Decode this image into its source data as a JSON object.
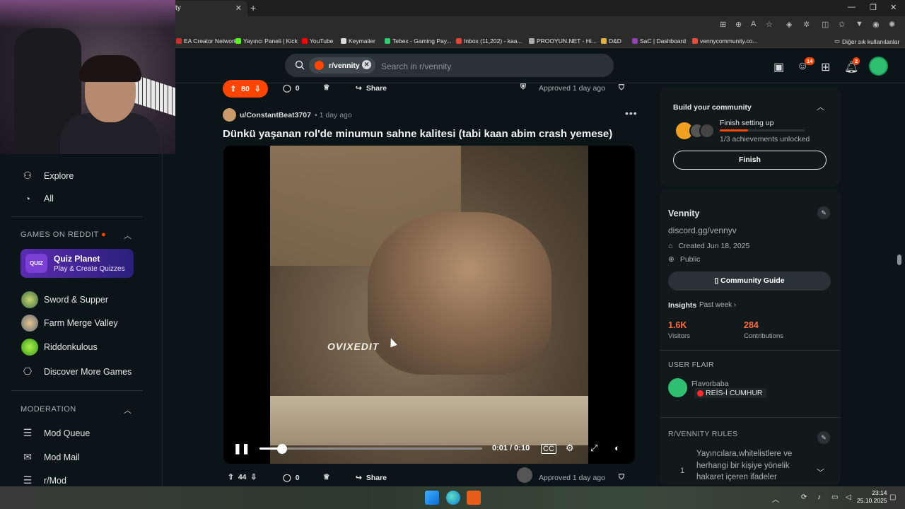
{
  "browser": {
    "tab_title": "ty",
    "bookmarks": [
      {
        "label": "EA Creator Network",
        "color": "#c9302c"
      },
      {
        "label": "Yayıncı Paneli | Kick",
        "color": "#53fc18"
      },
      {
        "label": "YouTube",
        "color": "#ff0000"
      },
      {
        "label": "Keymailer",
        "color": "#d9d9d9"
      },
      {
        "label": "Tebex - Gaming Pay...",
        "color": "#2ecc71"
      },
      {
        "label": "Inbox (11,202) - kaa...",
        "color": "#ea4335"
      },
      {
        "label": "PROOYUN.NET - Hi...",
        "color": "#aaaaaa"
      },
      {
        "label": "D&D",
        "color": "#e0b040"
      },
      {
        "label": "SaC | Dashboard",
        "color": "#8e44ad"
      },
      {
        "label": "vennycommunity.co...",
        "color": "#e74c3c"
      }
    ],
    "other_bookmarks": "Diğer sık kullanılanlar"
  },
  "header": {
    "community_chip": "r/vennity",
    "search_placeholder": "Search in r/vennity",
    "chat_badge": "14",
    "notif_badge": "2"
  },
  "sidebar": {
    "explore": "Explore",
    "all": "All",
    "games_heading": "GAMES ON REDDIT",
    "quiz": {
      "logo": "QUIZ",
      "title": "Quiz Planet",
      "subtitle": "Play & Create Quizzes"
    },
    "games": [
      "Sword & Supper",
      "Farm Merge Valley",
      "Riddonkulous"
    ],
    "discover": "Discover More Games",
    "moderation_heading": "MODERATION",
    "mod_items": [
      "Mod Queue",
      "Mod Mail",
      "r/Mod"
    ]
  },
  "post_prev": {
    "votes": "80",
    "comments": "0",
    "share": "Share",
    "approved": "Approved 1 day ago"
  },
  "post": {
    "user": "u/ConstantBeat3707",
    "time": "• 1 day ago",
    "title": "Dünkü yaşanan rol'de minumun sahne kalitesi (tabi kaan abim crash yemese)",
    "watermark": "OVIXEDIT",
    "video_time": "0:01 / 0:10",
    "progress": 0.1
  },
  "post_next": {
    "votes": "44",
    "comments": "0",
    "share": "Share",
    "approved": "Approved 1 day ago"
  },
  "right": {
    "build_title": "Build your community",
    "finish_title": "Finish setting up",
    "finish_sub": "1/3 achievements unlocked",
    "finish_progress": 0.33,
    "finish_btn": "Finish",
    "name": "Vennity",
    "desc": "discord.gg/vennyv",
    "created": "Created Jun 18, 2025",
    "visibility": "Public",
    "guide_btn": "Community Guide",
    "insights": "Insights",
    "insights_period": "Past week ›",
    "visitors_n": "1.6K",
    "visitors_l": "Visitors",
    "contrib_n": "284",
    "contrib_l": "Contributions",
    "user_flair_head": "USER FLAIR",
    "flair_user": "Flavorbaba",
    "flair_text": "REİS-İ CUMHUR",
    "rules_head": "R/VENNITY RULES",
    "rule1_num": "1",
    "rule1_text": "Yayıncılara,whitelistlere ve herhangi bir kişiye yönelik hakaret içeren ifadeler"
  },
  "taskbar": {
    "time": "23:14",
    "date": "25.10.2025"
  }
}
